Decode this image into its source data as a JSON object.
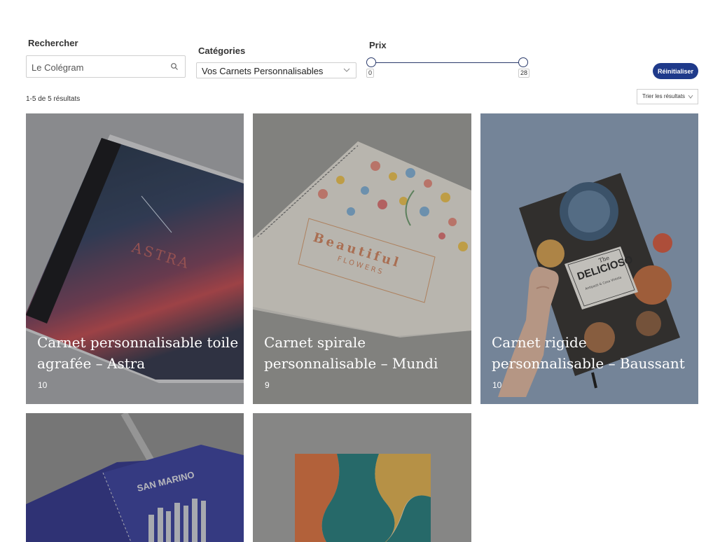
{
  "filters": {
    "search": {
      "label": "Rechercher",
      "value": "Le Colégram"
    },
    "category": {
      "label": "Catégories",
      "selected": "Vos Carnets Personnalisables"
    },
    "price": {
      "label": "Prix",
      "min": "0",
      "max": "28"
    },
    "reset_label": "Réinitialiser"
  },
  "results": {
    "count_text": "1-5 de 5 résultats",
    "sort_label": "Trier les résultats"
  },
  "products": [
    {
      "title": "Carnet personnalisable toile agrafée – Astra",
      "count": "10",
      "cover_text": "ASTRA"
    },
    {
      "title": "Carnet spirale personnalisable – Mundi",
      "count": "9",
      "cover_text": "Beautiful",
      "cover_sub": "FLOWERS"
    },
    {
      "title": "Carnet rigide personnalisable – Baussant",
      "count": "10",
      "cover_the": "The",
      "cover_text": "DELICIOSO",
      "cover_sub": "Antipasti & Cosa Vintola"
    },
    {
      "title": "",
      "count": "",
      "cover_text": "SAN MARINO"
    },
    {
      "title": "",
      "count": ""
    }
  ],
  "colors": {
    "accent": "#1f3a8a",
    "slider": "#2a3a6b"
  }
}
